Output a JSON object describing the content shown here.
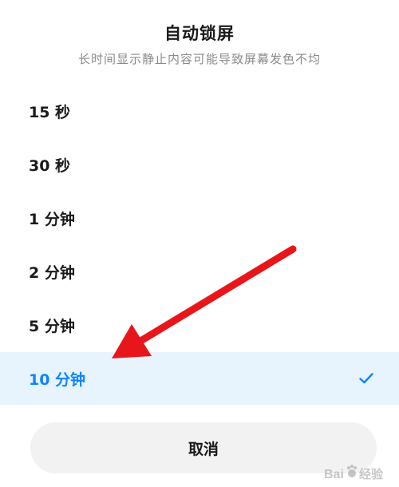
{
  "dialog": {
    "title": "自动锁屏",
    "subtitle": "长时间显示静止内容可能导致屏幕发色不均",
    "options": [
      {
        "label": "15 秒",
        "selected": false
      },
      {
        "label": "30 秒",
        "selected": false
      },
      {
        "label": "1 分钟",
        "selected": false
      },
      {
        "label": "2 分钟",
        "selected": false
      },
      {
        "label": "5 分钟",
        "selected": false
      },
      {
        "label": "10 分钟",
        "selected": true
      }
    ],
    "cancel_label": "取消"
  },
  "colors": {
    "accent": "#0d84ff",
    "selected_bg": "#e7f3fd",
    "annotation_arrow": "#e8161b",
    "cancel_bg": "#f2f2f2"
  },
  "icons": {
    "selected_mark": "checkmark-icon"
  },
  "watermark": {
    "text": "Baidu 经验"
  }
}
